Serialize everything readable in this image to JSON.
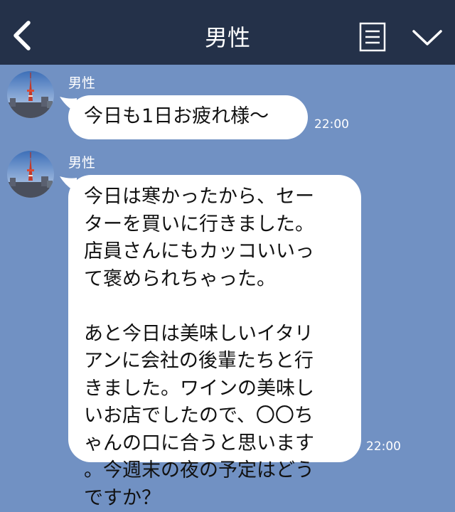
{
  "header": {
    "title": "男性",
    "back_icon": "chevron-left-icon",
    "menu_icon": "menu-icon",
    "more_icon": "chevron-down-icon"
  },
  "colors": {
    "header_bg": "#243149",
    "chat_bg": "#7191c3",
    "bubble_bg": "#ffffff"
  },
  "messages": [
    {
      "sender": "男性",
      "lines": [
        "今日も1日お疲れ様〜"
      ],
      "time": "22:00"
    },
    {
      "sender": "男性",
      "lines": [
        "今日は寒かったから、セー",
        "ターを買いに行きました。",
        "店員さんにもカッコいいっ",
        "て褒められちゃった。",
        "",
        "あと今日は美味しいイタリ",
        "アンに会社の後輩たちと行",
        "きました。ワインの美味し",
        "いお店でしたので、〇〇ち",
        "ゃんの口に合うと思います",
        "。今週末の夜の予定はどう",
        "ですか？"
      ],
      "time": "22:00"
    }
  ]
}
